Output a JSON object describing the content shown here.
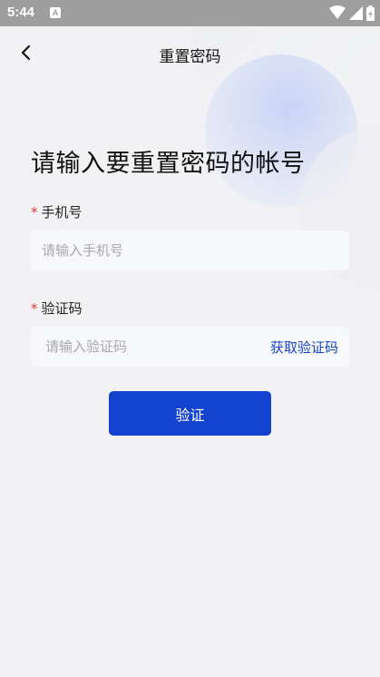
{
  "status_bar": {
    "time": "5:44",
    "notification_letter": "A"
  },
  "nav": {
    "title": "重置密码"
  },
  "heading": "请输入要重置密码的帐号",
  "phone": {
    "required_mark": "*",
    "label": "手机号",
    "placeholder": "请输入手机号",
    "value": ""
  },
  "code": {
    "required_mark": "*",
    "label": "验证码",
    "placeholder": "请输入验证码",
    "value": "",
    "get_code_label": "获取验证码"
  },
  "submit": {
    "label": "验证"
  },
  "colors": {
    "accent": "#1342cf",
    "link": "#1a46c8",
    "required": "#e53935",
    "background": "#f2f2f4",
    "input_bg": "#f7f8fa"
  }
}
